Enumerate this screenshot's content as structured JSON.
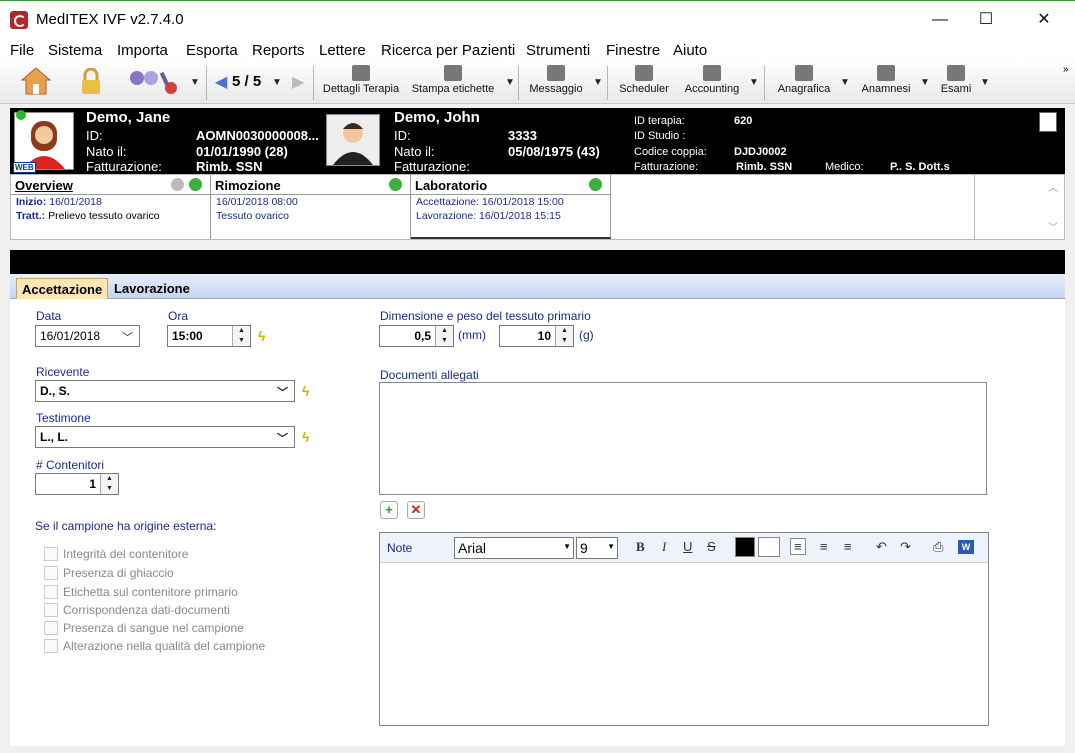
{
  "window": {
    "title": "MedITEX IVF v2.7.4.0",
    "minimize": "—",
    "maximize": "☐",
    "close": "✕"
  },
  "menu": [
    "File",
    "Sistema",
    "Importa",
    "Esporta",
    "Reports",
    "Lettere",
    "Ricerca per Pazienti",
    "Strumenti",
    "Finestre",
    "Aiuto"
  ],
  "toolbar": {
    "nav_counter": "5 / 5",
    "items": [
      "Dettagli Terapia",
      "Stampa etichette",
      "Messaggio",
      "Scheduler",
      "Accounting",
      "Anagrafica",
      "Anamnesi",
      "Esami"
    ]
  },
  "patient_female": {
    "name": "Demo, Jane",
    "id_label": "ID:",
    "id_value": "AOMN0030000008...",
    "dob_label": "Nato il:",
    "dob_value": "01/01/1990  (28)",
    "billing_label": "Fatturazione:",
    "billing_value": "Rimb. SSN",
    "badge": "WEB"
  },
  "patient_male": {
    "name": "Demo, John",
    "id_label": "ID:",
    "id_value": "3333",
    "dob_label": "Nato il:",
    "dob_value": "05/08/1975  (43)",
    "billing_label": "Fatturazione:",
    "billing_value": ""
  },
  "therapy": {
    "id_label": "ID terapia:",
    "id_value": "620",
    "study_label": "ID Studio :",
    "study_value": "",
    "couple_label": "Codice coppia:",
    "couple_value": "DJDJ0002",
    "billing_label": "Fatturazione:",
    "billing_value": "Rimb. SSN",
    "doctor_label": "Medico:",
    "doctor_value": "P.. S. Dott.s"
  },
  "steps": {
    "overview": {
      "title": "Overview",
      "line1_label": "Inizio:",
      "line1": "16/01/2018",
      "line2_label": "Tratt.:",
      "line2": "Prelievo tessuto ovarico"
    },
    "rimozione": {
      "title": "Rimozione",
      "line1": "16/01/2018 08:00",
      "line2": "Tessuto ovarico"
    },
    "laboratorio": {
      "title": "Laboratorio",
      "line1": "Accettazione: 16/01/2018 15:00",
      "line2": "Lavorazione: 16/01/2018 15:15"
    }
  },
  "tabs": [
    "Accettazione",
    "Lavorazione"
  ],
  "form": {
    "data_label": "Data",
    "data_value": "16/01/2018",
    "ora_label": "Ora",
    "ora_value": "15:00",
    "ricevente_label": "Ricevente",
    "ricevente_value": "D., S.",
    "testimone_label": "Testimone",
    "testimone_value": "L., L.",
    "contenitori_label": "# Contenitori",
    "contenitori_value": "1",
    "external_label": "Se il campione ha origine esterna:",
    "checkboxes": [
      "Integrità del contenitore",
      "Presenza di ghiaccio",
      "Etichetta sul contenitore primario",
      "Corrispondenza dati-documenti",
      "Presenza di sangue nel campione",
      "Alterazione nella qualità del campione"
    ],
    "dimension_label": "Dimensione e peso del tessuto primario",
    "mm_value": "0,5",
    "mm_unit": "(mm)",
    "g_value": "10",
    "g_unit": "(g)",
    "documenti_label": "Documenti allegati",
    "note_label": "Note",
    "font_name": "Arial",
    "font_size": "9"
  },
  "colors": {
    "label_blue": "#1a2a8a",
    "active_tab": "#fbe6b4",
    "header_bg": "#000000",
    "ok_green": "#3db03d"
  }
}
